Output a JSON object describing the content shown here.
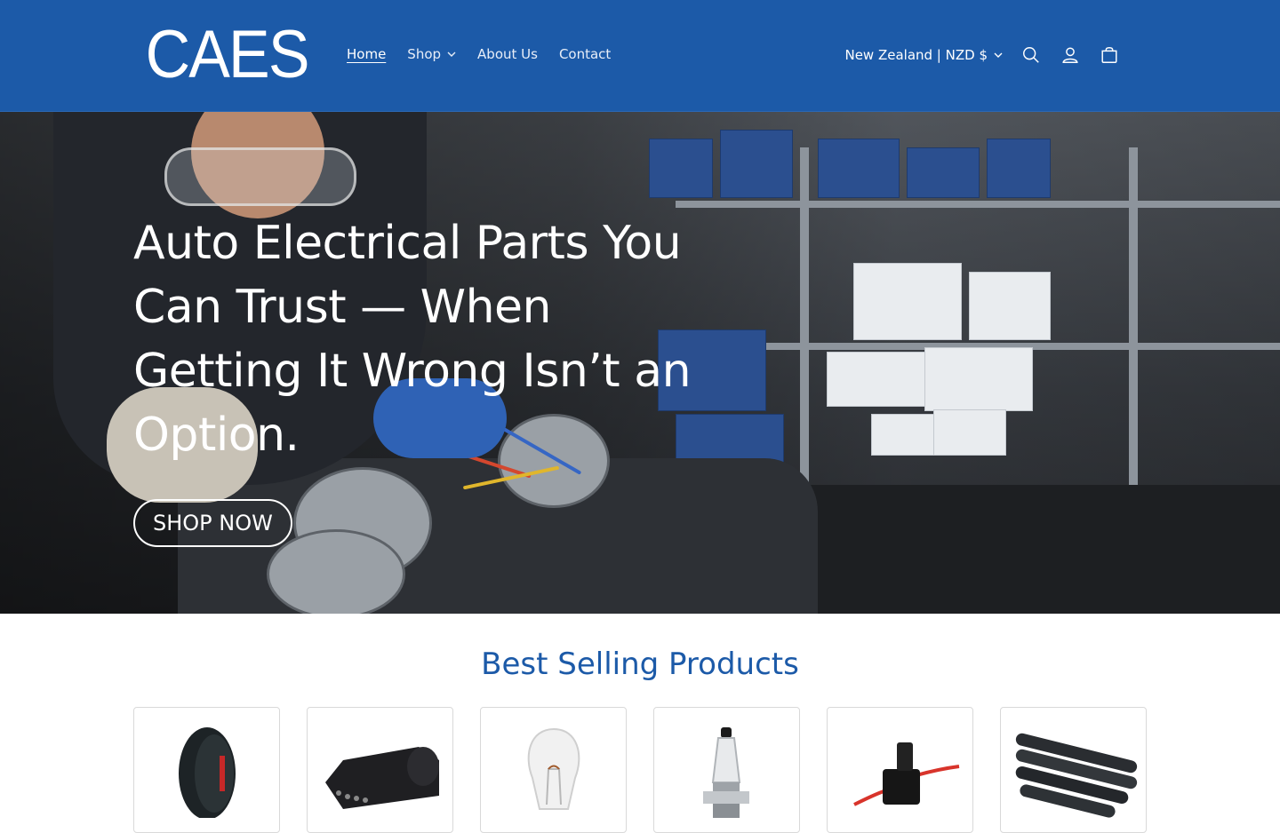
{
  "header": {
    "logo_text": "CAES",
    "nav": [
      {
        "label": "Home",
        "active": true,
        "dropdown": false
      },
      {
        "label": "Shop",
        "active": false,
        "dropdown": true
      },
      {
        "label": "About Us",
        "active": false,
        "dropdown": false
      },
      {
        "label": "Contact",
        "active": false,
        "dropdown": false
      }
    ],
    "country_selector": "New Zealand | NZD $",
    "icons": [
      "search-icon",
      "account-icon",
      "cart-icon"
    ],
    "background_color": "#1c5aa8"
  },
  "hero": {
    "title": "Auto Electrical Parts You Can Trust — When Getting It Wrong Isn’t an Option.",
    "button_label": "SHOP NOW"
  },
  "best_sellers": {
    "title": "Best Selling Products",
    "products": [
      {
        "image": "electrical-tape"
      },
      {
        "image": "trailer-plug"
      },
      {
        "image": "bulb"
      },
      {
        "image": "halogen-bulb"
      },
      {
        "image": "inline-fuse-holder"
      },
      {
        "image": "heat-shrink-tubing"
      }
    ]
  }
}
